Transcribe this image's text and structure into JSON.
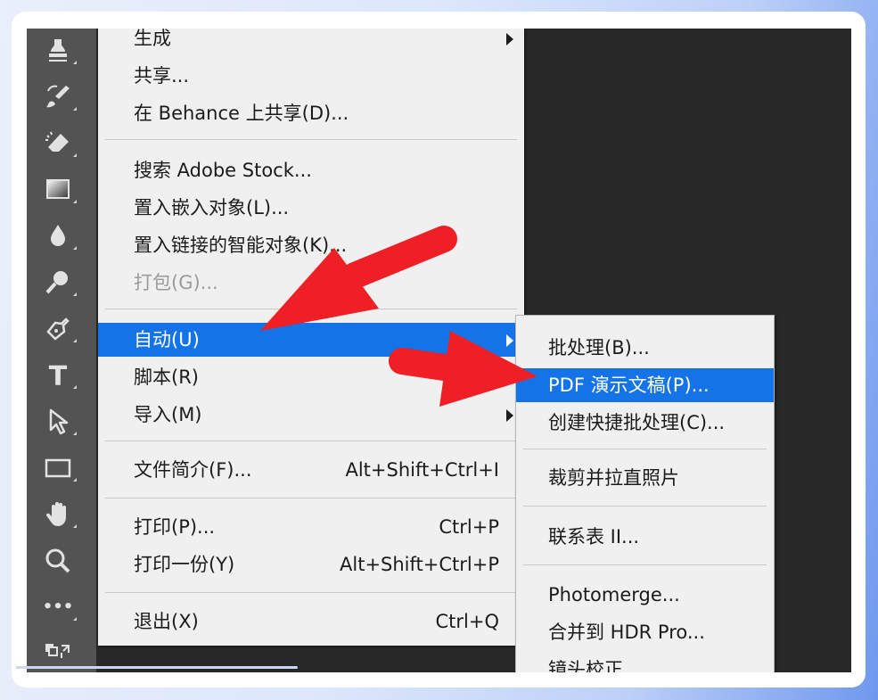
{
  "toolbar": {
    "tools": [
      {
        "name": "clone-stamp-tool-icon"
      },
      {
        "name": "history-brush-tool-icon"
      },
      {
        "name": "eraser-tool-icon"
      },
      {
        "name": "gradient-tool-icon"
      },
      {
        "name": "blur-tool-icon"
      },
      {
        "name": "dodge-tool-icon"
      },
      {
        "name": "pen-tool-icon"
      },
      {
        "name": "type-tool-icon",
        "glyph": "T"
      },
      {
        "name": "path-selection-tool-icon"
      },
      {
        "name": "rectangle-tool-icon"
      },
      {
        "name": "hand-tool-icon"
      },
      {
        "name": "zoom-tool-icon"
      },
      {
        "name": "more-tools-icon",
        "glyph": "•••"
      },
      {
        "name": "swap-colors-icon"
      }
    ]
  },
  "file_menu": {
    "items": [
      {
        "label": "生成",
        "submenu": true
      },
      {
        "label": "共享..."
      },
      {
        "label": "在 Behance 上共享(D)..."
      },
      {
        "label": "搜索 Adobe Stock..."
      },
      {
        "label": "置入嵌入对象(L)..."
      },
      {
        "label": "置入链接的智能对象(K)..."
      },
      {
        "label": "打包(G)...",
        "disabled": true
      },
      {
        "label": "自动(U)",
        "submenu": true,
        "active": true
      },
      {
        "label": "脚本(R)"
      },
      {
        "label": "导入(M)",
        "submenu": true
      },
      {
        "label": "文件简介(F)...",
        "shortcut": "Alt+Shift+Ctrl+I"
      },
      {
        "label": "打印(P)...",
        "shortcut": "Ctrl+P"
      },
      {
        "label": "打印一份(Y)",
        "shortcut": "Alt+Shift+Ctrl+P"
      },
      {
        "label": "退出(X)",
        "shortcut": "Ctrl+Q"
      }
    ]
  },
  "automate_menu": {
    "items": [
      {
        "label": "批处理(B)..."
      },
      {
        "label": "PDF 演示文稿(P)...",
        "active": true
      },
      {
        "label": "创建快捷批处理(C)..."
      },
      {
        "label": "裁剪并拉直照片"
      },
      {
        "label": "联系表 II..."
      },
      {
        "label": "Photomerge..."
      },
      {
        "label": "合并到 HDR Pro..."
      },
      {
        "label": "镜头校正..."
      }
    ]
  },
  "colors": {
    "highlight": "#1473e6",
    "annotation_arrow": "#ee1f25",
    "menu_bg": "#f0f0f0",
    "toolbar_bg": "#535353",
    "canvas_bg": "#282828"
  }
}
